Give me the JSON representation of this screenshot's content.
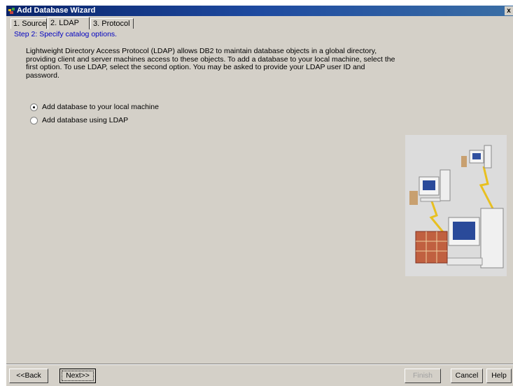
{
  "window": {
    "title": "Add Database Wizard",
    "close_glyph": "x"
  },
  "tabs": [
    {
      "label": "1. Source"
    },
    {
      "label": "2. LDAP",
      "active": true
    },
    {
      "label": "3. Protocol"
    }
  ],
  "step_text": "Step 2: Specify catalog options.",
  "description": "Lightweight Directory Access Protocol (LDAP) allows DB2 to maintain database objects in a global directory, providing client and server machines access to these objects.  To add a database to your local machine, select the first option.  To use LDAP, select the second option.  You may be asked to provide your LDAP user ID and password.",
  "options": [
    {
      "label": "Add database to your local machine",
      "selected": true
    },
    {
      "label": "Add database using LDAP",
      "selected": false
    }
  ],
  "buttons": {
    "back": "<<Back",
    "next": "Next>>",
    "finish": "Finish",
    "cancel": "Cancel",
    "help": "Help"
  },
  "colors": {
    "title_bar": "#0a246a",
    "window_bg": "#d4d0c8",
    "step_text": "#0000c0"
  },
  "illustration": {
    "icon": "network-computers-illustration"
  }
}
